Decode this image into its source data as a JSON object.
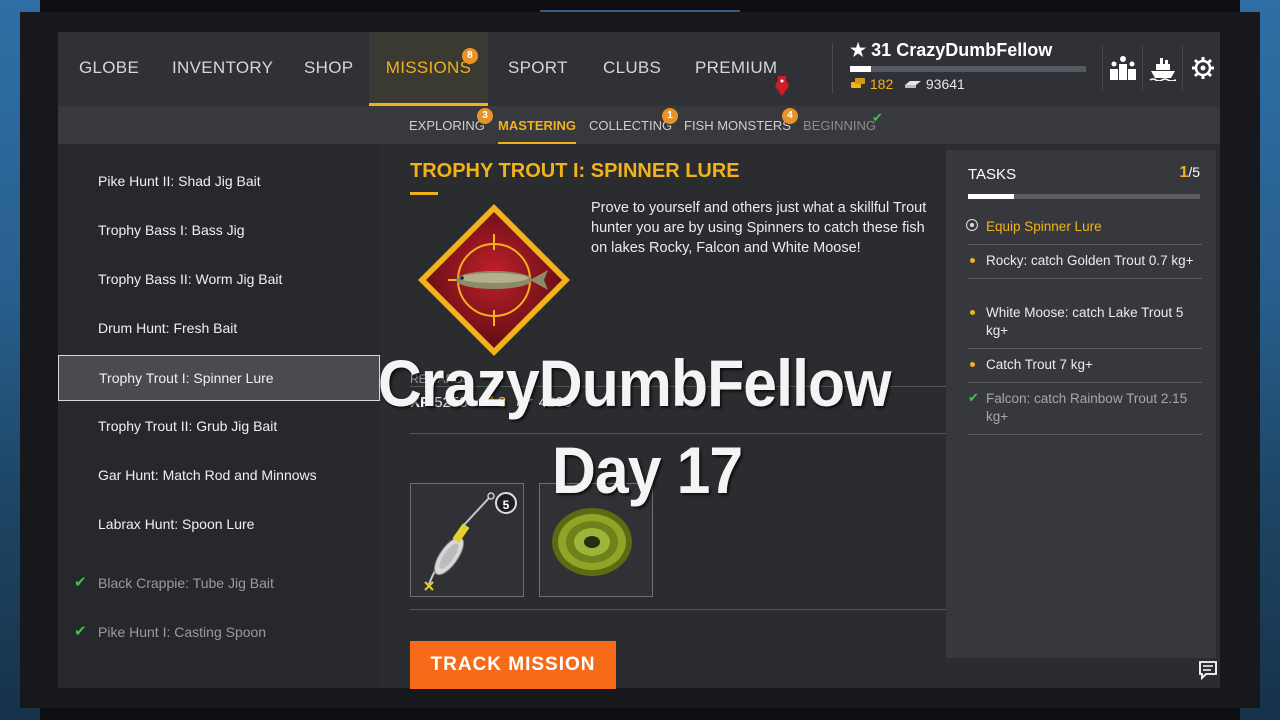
{
  "nav": {
    "items": [
      {
        "label": "GLOBE"
      },
      {
        "label": "INVENTORY"
      },
      {
        "label": "SHOP"
      },
      {
        "label": "MISSIONS",
        "badge": "8"
      },
      {
        "label": "SPORT"
      },
      {
        "label": "CLUBS"
      },
      {
        "label": "PREMIUM"
      }
    ],
    "active": "MISSIONS"
  },
  "player": {
    "level": "31",
    "name": "CrazyDumbFellow",
    "xp_progress": 0.09,
    "gold": "182",
    "silver": "93641"
  },
  "icons": [
    "leaderboard-icon",
    "ship-icon",
    "settings-icon"
  ],
  "subnav": {
    "items": [
      {
        "label": "EXPLORING",
        "badge": "3"
      },
      {
        "label": "MASTERING"
      },
      {
        "label": "COLLECTING",
        "badge": "1"
      },
      {
        "label": "FISH MONSTERS",
        "badge": "4"
      },
      {
        "label": "BEGINNING"
      }
    ],
    "active": "MASTERING"
  },
  "missions": [
    {
      "label": "Pike Hunt II: Shad Jig Bait",
      "done": false
    },
    {
      "label": "Trophy Bass I: Bass Jig",
      "done": false
    },
    {
      "label": "Trophy Bass II: Worm Jig Bait",
      "done": false
    },
    {
      "label": "Drum Hunt: Fresh Bait",
      "done": false
    },
    {
      "label": "Trophy Trout I: Spinner Lure",
      "done": false,
      "selected": true
    },
    {
      "label": "Trophy Trout II: Grub Jig Bait",
      "done": false
    },
    {
      "label": "Gar Hunt: Match Rod and Minnows",
      "done": false
    },
    {
      "label": "Labrax Hunt: Spoon Lure",
      "done": false
    },
    {
      "label": "Black Crappie: Tube Jig Bait",
      "done": true
    },
    {
      "label": "Pike Hunt I: Casting Spoon",
      "done": true
    }
  ],
  "detail": {
    "title": "TROPHY TROUT I: SPINNER LURE",
    "description": "Prove to yourself and others just what a skillful Trout hunter you are by using Spinners to catch these fish on lakes Rocky, Falcon and White Moose!",
    "rewards_label": "REWARDS",
    "xp_label": "XP",
    "xp": "5250",
    "gold": "3",
    "silver": "4200",
    "item_quantity": "5",
    "track_button": "TRACK MISSION"
  },
  "tasks": {
    "heading": "TASKS",
    "completed": "1",
    "total": "/5",
    "progress": 0.2,
    "items": [
      {
        "label": "Equip Spinner Lure",
        "state": "current"
      },
      {
        "label": "Rocky: catch Golden Trout 0.7 kg+",
        "state": "pending"
      },
      {
        "label": "White Moose: catch Lake Trout 5 kg+",
        "state": "pending"
      },
      {
        "label": "Catch Trout 7 kg+",
        "state": "pending"
      },
      {
        "label": "Falcon: catch Rainbow Trout 2.15 kg+",
        "state": "done"
      }
    ]
  },
  "overlay": {
    "line1": "CrazyDumbFellow",
    "line2": "Day 17"
  },
  "colors": {
    "accent": "#f2b21b",
    "button": "#f56b1a",
    "check": "#3ec443"
  }
}
